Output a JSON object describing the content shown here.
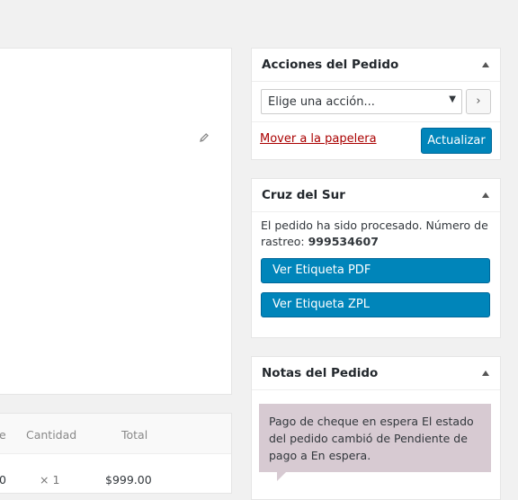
{
  "items_table": {
    "headers": [
      "e",
      "Cantidad",
      "Total"
    ],
    "row": {
      "cost_fragment": "0",
      "qty": "× 1",
      "total": "$999.00"
    }
  },
  "actions_panel": {
    "title": "Acciones del Pedido",
    "select_value": "Elige una acción...",
    "go_label": "›",
    "trash_label": "Mover a la papelera",
    "update_label": "Actualizar"
  },
  "cruz_panel": {
    "title": "Cruz del Sur",
    "message": "El pedido ha sido procesado. Número de rastreo: ",
    "tracking_number": "999534607",
    "pdf_label": "Ver Etiqueta PDF",
    "zpl_label": "Ver Etiqueta ZPL"
  },
  "notes_panel": {
    "title": "Notas del Pedido",
    "note_text": "Pago de cheque en espera El estado del pedido cambió de Pendiente de pago a En espera."
  },
  "colors": {
    "primary": "#0085ba",
    "trash": "#a00",
    "note_bg": "#d7cad2"
  },
  "icons": [
    "pencil-icon",
    "chevron-up-icon",
    "caret-down-icon"
  ]
}
